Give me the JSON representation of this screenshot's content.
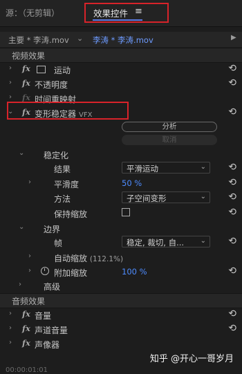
{
  "tabs": {
    "source": "源：（无剪辑）",
    "effects": "效果控件",
    "menu_glyph": "≡"
  },
  "clipbar": {
    "master": "主要 * 李涛.mov",
    "current": "李涛 * 李涛.mov"
  },
  "video_effects": {
    "header": "视频效果",
    "motion": "运动",
    "opacity": "不透明度",
    "time_remap": "时间重映射",
    "stabilizer": {
      "name": "变形稳定器",
      "suffix": "VFX"
    },
    "analyze": "分析",
    "cancel": "取消",
    "stabilization": "稳定化",
    "result": {
      "label": "结果",
      "value": "平滑运动"
    },
    "smoothness": {
      "label": "平滑度",
      "value": "50 %"
    },
    "method": {
      "label": "方法",
      "value": "子空间变形"
    },
    "keep_scale": {
      "label": "保持缩放",
      "checked": false
    },
    "borders": "边界",
    "framing": {
      "label": "帧",
      "value": "稳定, 裁切, 自..."
    },
    "auto_scale": {
      "label": "自动缩放",
      "detail": "(112.1%)"
    },
    "additional_scale": {
      "label": "附加缩放",
      "value": "100 %"
    },
    "advanced": "高级"
  },
  "audio_effects": {
    "header": "音频效果",
    "volume": "音量",
    "channel_volume": "声道音量",
    "panner": "声像器"
  },
  "reset_glyph": "⟲",
  "watermark": "知乎 @开心一哥岁月",
  "timecode": "00:00:01:01",
  "colors": {
    "accent": "#4e8cff",
    "highlight_box": "#d8232a",
    "background": "#1d1d1d"
  }
}
